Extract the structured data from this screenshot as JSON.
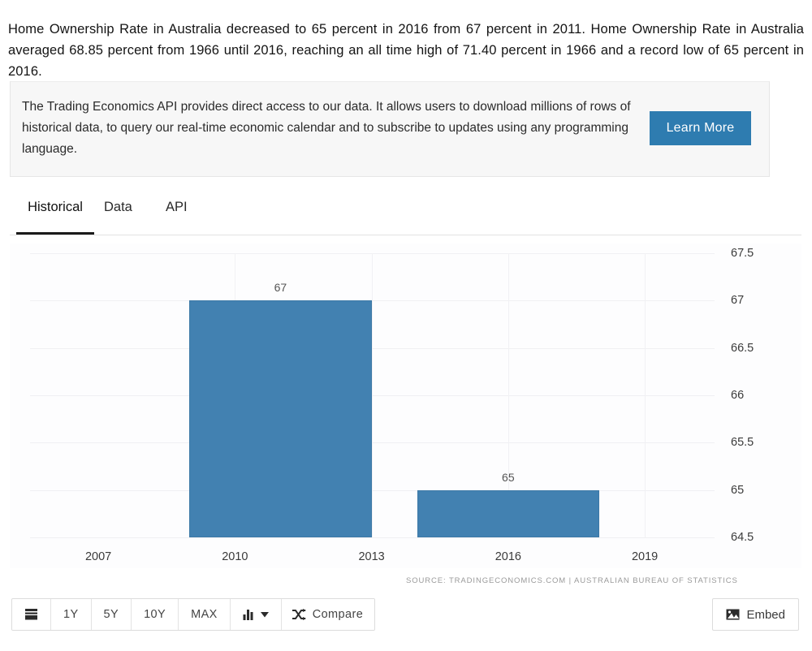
{
  "intro": {
    "text": "Home Ownership Rate in Australia decreased to 65 percent in 2016 from 67 percent in 2011. Home Ownership Rate in Australia averaged 68.85 percent from 1966 until 2016, reaching an all time high of 71.40 percent in 1966 and a record low of 65 percent in 2016."
  },
  "api_box": {
    "text": "The Trading Economics API provides direct access to our data. It allows users to download millions of rows of historical data, to query our real-time economic calendar and to subscribe to updates using any programming language.",
    "button_label": "Learn More",
    "button_color": "#2e7cb0"
  },
  "tabs": [
    {
      "label": "Historical",
      "active": true
    },
    {
      "label": "Data",
      "active": false
    },
    {
      "label": "API",
      "active": false
    }
  ],
  "chart_data": {
    "type": "bar",
    "title": "",
    "xlabel": "",
    "ylabel": "",
    "categories": [
      "2011",
      "2016"
    ],
    "values": [
      67,
      65
    ],
    "data_labels": [
      "67",
      "65"
    ],
    "ylim": [
      64.5,
      67.5
    ],
    "ytick_labels": [
      "67.5",
      "67",
      "66.5",
      "66",
      "65.5",
      "65",
      "64.5"
    ],
    "ytick_values": [
      67.5,
      67,
      66.5,
      66,
      65.5,
      65,
      64.5
    ],
    "xtick_labels": [
      "2007",
      "2010",
      "2013",
      "2016",
      "2019"
    ],
    "xtick_values": [
      2007,
      2010,
      2013,
      2016,
      2019
    ],
    "xlim": [
      2005.5,
      2020.3
    ],
    "grid": true,
    "legend": false,
    "bar_color": "#4281b1",
    "series": [
      {
        "name": "Home Ownership Rate",
        "values": [
          67,
          65
        ]
      }
    ]
  },
  "source": "SOURCE: TRADINGECONOMICS.COM | AUSTRALIAN BUREAU OF STATISTICS",
  "toolbar": {
    "buttons": [
      {
        "label": "",
        "icon": "calendar-icon"
      },
      {
        "label": "1Y",
        "icon": ""
      },
      {
        "label": "5Y",
        "icon": ""
      },
      {
        "label": "10Y",
        "icon": ""
      },
      {
        "label": "MAX",
        "icon": ""
      },
      {
        "label": "",
        "icon": "bar-chart-dropdown-icon"
      },
      {
        "label": "Compare",
        "icon": "shuffle-icon"
      }
    ],
    "embed_label": "Embed",
    "embed_icon": "image-icon"
  }
}
